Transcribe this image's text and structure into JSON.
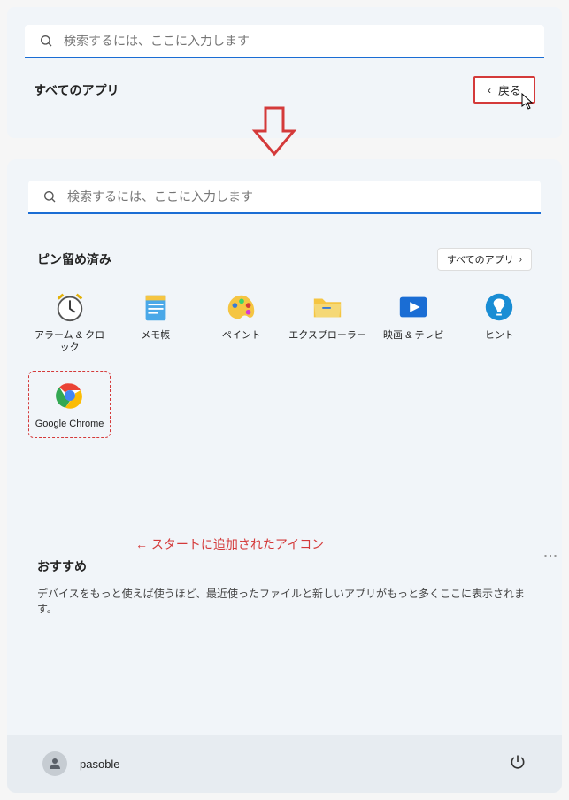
{
  "search": {
    "placeholder": "検索するには、ここに入力します"
  },
  "top_panel": {
    "all_apps_label": "すべてのアプリ",
    "back_label": "戻る"
  },
  "pinned": {
    "title": "ピン留め済み",
    "all_apps_button": "すべてのアプリ",
    "apps": [
      {
        "label": "アラーム & クロック",
        "icon": "alarm"
      },
      {
        "label": "メモ帳",
        "icon": "notepad"
      },
      {
        "label": "ペイント",
        "icon": "paint"
      },
      {
        "label": "エクスプローラー",
        "icon": "explorer"
      },
      {
        "label": "映画 & テレビ",
        "icon": "movies"
      },
      {
        "label": "ヒント",
        "icon": "tips"
      },
      {
        "label": "Google Chrome",
        "icon": "chrome",
        "highlighted": true
      }
    ]
  },
  "annotation": {
    "text": "← スタートに追加されたアイコン"
  },
  "recommended": {
    "title": "おすすめ",
    "text": "デバイスをもっと使えば使うほど、最近使ったファイルと新しいアプリがもっと多くここに表示されます。"
  },
  "footer": {
    "username": "pasoble"
  }
}
